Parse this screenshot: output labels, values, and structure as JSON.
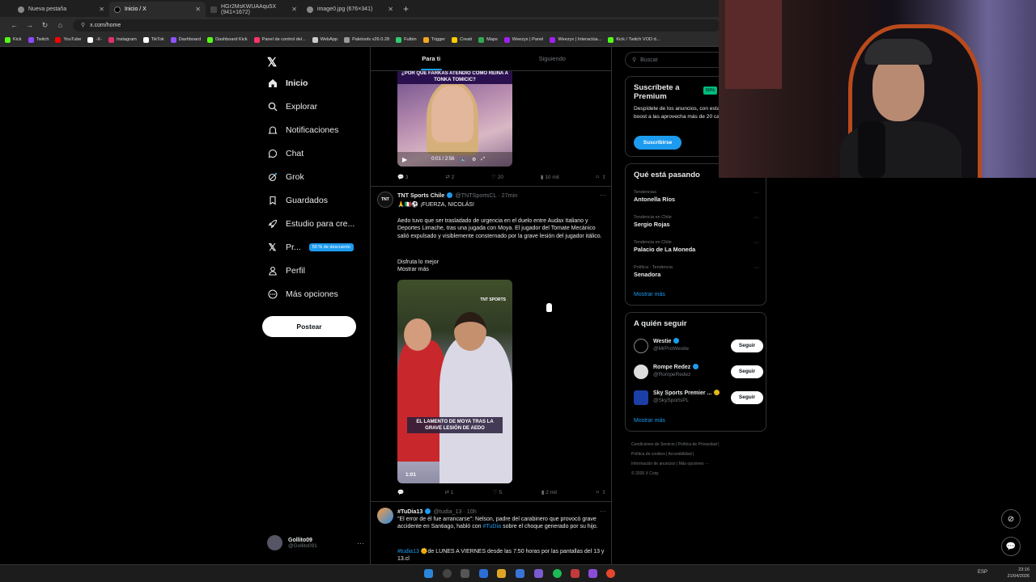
{
  "browser": {
    "tabs": [
      {
        "title": "Nueva pestaña",
        "active": false
      },
      {
        "title": "Inicio / X",
        "active": true
      },
      {
        "title": "HGr2MsKWUAAqu5X (941×1672)",
        "active": false
      },
      {
        "title": "image0.jpg (676×341)",
        "active": false
      }
    ],
    "url": "x.com/home",
    "bookmarks": [
      "Kick",
      "Twitch",
      "YouTube",
      "-X-",
      "Instagram",
      "TikTok",
      "Dashboard",
      "Dashboard Kick",
      "Panel de control del...",
      "WebApp",
      "Paletools v26.0.28",
      "Futbin",
      "Trigger",
      "Creati",
      "Maps",
      "Weezyx | Panel",
      "Weezyx | Interactúa...",
      "Kick / Twitch VOD d..."
    ]
  },
  "nav": {
    "items": [
      "Inicio",
      "Explorar",
      "Notificaciones",
      "Chat",
      "Grok",
      "Guardados",
      "Estudio para cre...",
      "Pr...",
      "Perfil",
      "Más opciones"
    ],
    "premium_badge": "50 % de descuento",
    "post_label": "Postear",
    "account": {
      "name": "Gollito09",
      "handle": "@Gollito091"
    }
  },
  "feed": {
    "tabs": [
      "Para ti",
      "Siguiendo"
    ],
    "post1": {
      "caption": "¿POR QUÉ FARKAS ATENDIÓ COMO REINA A TONKA TOMICIC?",
      "video_time": "0:01 / 2:56",
      "replies": "3",
      "reposts": "2",
      "likes": "20",
      "views": "10 mil"
    },
    "post2": {
      "name": "TNT Sports Chile",
      "handle": "@TNTSportsCL",
      "time": "· 27min",
      "headline": "🙏🇮🇹⚽ ¡FUERZA, NICOLÁS!",
      "body": "Aedo tuvo que ser trasladado de urgencia en el duelo entre Audax Italiano y Deportes Limache, tras una jugada con Moya. El jugador del Tomate Mecánico salió expulsado y visiblemente consternado por la grave lesión del jugador itálico.",
      "extra": "Disfruta lo mejor",
      "show_more": "Mostrar más",
      "video_banner": "EL LAMENTO DE MOYA TRAS LA GRAVE LESIÓN DE AEDO",
      "video_time": "1:01",
      "watermark": "TNT SPORTS",
      "replies": "",
      "reposts": "1",
      "likes": "5",
      "views": "2 mil"
    },
    "post3": {
      "name": "#TuDía13",
      "handle": "@tudia_13",
      "time": "· 10h",
      "body_a": "\"El error de él fue arrancarse\": Nelson, padre del carabinero que provocó grave accidente en Santiago, habló con ",
      "body_tag": "#TuDía",
      "body_b": " sobre el choque generado por su hijo.",
      "line2_tag": "#tudia13",
      "line2": " 🌞de LUNES A VIERNES desde las 7:50 horas por las pantallas del 13 y 13.cl"
    }
  },
  "sidebar": {
    "search_placeholder": "Buscar",
    "premium": {
      "title": "Suscríbete a Premium",
      "badge": "50%",
      "text": "Despídete de los anuncios, con estadísticas, aplica boost a las aprovecha más de 20 caracter",
      "button": "Suscribirse"
    },
    "trends_title": "Qué está pasando",
    "trends": [
      {
        "context": "Tendencias",
        "topic": "Antonella Ríos"
      },
      {
        "context": "Tendencia en Chile",
        "topic": "Sergio Rojas"
      },
      {
        "context": "Tendencia en Chile",
        "topic": "Palacio de La Moneda"
      },
      {
        "context": "Política · Tendencia",
        "topic": "Senadora"
      }
    ],
    "show_more": "Mostrar más",
    "follow_title": "A quién seguir",
    "follow": [
      {
        "name": "Westie",
        "handle": "@MrProWestie",
        "button": "Seguir"
      },
      {
        "name": "Rompe Redez",
        "handle": "@RompeRedez",
        "button": "Seguir"
      },
      {
        "name": "Sky Sports Premier ...",
        "handle": "@SkySportsPL",
        "button": "Seguir"
      }
    ],
    "follow_more": "Mostrar más",
    "footer": [
      "Condiciones de Servicio",
      "Política de Privacidad",
      "Política de cookies",
      "Accesibilidad",
      "Información de anuncios",
      "Más opciones ···",
      "© 2026 X Corp."
    ]
  },
  "taskbar": {
    "lang": "ESP",
    "lang2": "LAA",
    "time": "23:16",
    "date": "21/04/2026"
  },
  "colors": {
    "accent": "#1d9bf0",
    "background": "#000000",
    "muted": "#71767b",
    "premium_green": "#00ba7c"
  }
}
